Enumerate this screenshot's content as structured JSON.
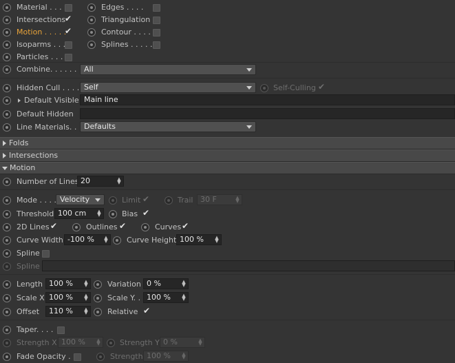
{
  "rows": {
    "material": {
      "label": "Material . . . ."
    },
    "edges": {
      "label": "Edges . . . ."
    },
    "intersections": {
      "label": "Intersections",
      "check": "✔"
    },
    "triangulation": {
      "label": "Triangulation"
    },
    "motion": {
      "label": "Motion . . . . .",
      "check": "✔"
    },
    "contour": {
      "label": "Contour . . . ."
    },
    "isoparms": {
      "label": "Isoparms . . ."
    },
    "splines": {
      "label": "Splines . . . . ."
    },
    "particles": {
      "label": "Particles . . ."
    },
    "combine": {
      "label": "Combine. . . . . . . .",
      "value": "All"
    },
    "hidden_cull": {
      "label": "Hidden Cull . . . .",
      "value": "Self",
      "self_culling_label": "Self-Culling",
      "check": "✔"
    },
    "default_visible": {
      "label": "Default Visible",
      "value": "Main line"
    },
    "default_hidden": {
      "label": "Default Hidden",
      "value": ""
    },
    "line_materials": {
      "label": "Line Materials. . .",
      "value": "Defaults"
    }
  },
  "sections": {
    "folds": "Folds",
    "intersections": "Intersections",
    "motion": "Motion"
  },
  "motion": {
    "number_of_lines": {
      "label": "Number of Lines",
      "value": "20"
    },
    "mode": {
      "label": "Mode . . . .",
      "value": "Velocity",
      "limit_label": "Limit",
      "limit_check": "✔",
      "trail_label": "Trail",
      "trail_value": "30 F"
    },
    "threshold": {
      "label": "Threshold",
      "value": "100 cm",
      "bias_label": "Bias",
      "bias_check": "✔"
    },
    "lines2d": {
      "label": "2D Lines",
      "check": "✔",
      "outlines_label": "Outlines",
      "outlines_check": "✔",
      "curves_label": "Curves",
      "curves_check": "✔"
    },
    "curve_width": {
      "label": "Curve Width",
      "value": "-100 %",
      "height_label": "Curve Height",
      "height_value": "100 %"
    },
    "spline": {
      "label": "Spline"
    },
    "spline_link": {
      "label": "Spline",
      "value": ""
    },
    "length": {
      "label": "Length",
      "value": "100 %",
      "variation_label": "Variation",
      "variation_value": "0 %"
    },
    "scale": {
      "x_label": "Scale X",
      "x_value": "100 %",
      "y_label": "Scale Y. .",
      "y_value": "100 %"
    },
    "offset": {
      "label": "Offset",
      "value": "110 %",
      "relative_label": "Relative",
      "relative_check": "✔"
    },
    "taper": {
      "label": "Taper. . . ."
    },
    "strength": {
      "x_label": "Strength X",
      "x_value": "100 %",
      "y_label": "Strength Y",
      "y_value": "0 %"
    },
    "fade": {
      "label": "Fade Opacity .",
      "strength_label": "Strength",
      "strength_value": "100 %"
    }
  },
  "colors": {
    "background": "#343434",
    "accent": "#e8a33a",
    "section_bar": "#484848"
  }
}
